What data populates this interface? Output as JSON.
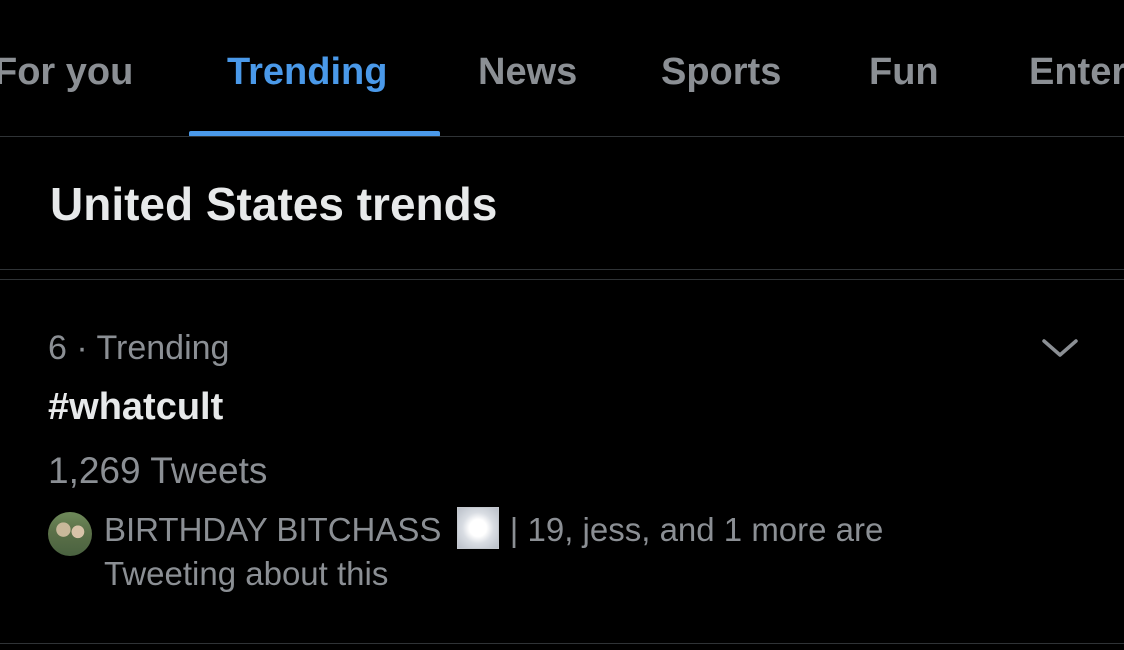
{
  "tabs": [
    {
      "label": "For you",
      "active": false
    },
    {
      "label": "Trending",
      "active": true
    },
    {
      "label": "News",
      "active": false
    },
    {
      "label": "Sports",
      "active": false
    },
    {
      "label": "Fun",
      "active": false
    },
    {
      "label": "Entertainment",
      "active": false
    }
  ],
  "section": {
    "title": "United States trends"
  },
  "trend": {
    "meta": "6 · Trending",
    "name": "#whatcult",
    "count": "1,269 Tweets",
    "social_name": "BIRTHDAY BITCHASS",
    "social_rest": "| 19, jess, and 1 more are Tweeting about this",
    "menu_icon": "chevron-down-icon",
    "emoji_icon": "sparkle-emoji-icon"
  },
  "colors": {
    "background": "#000000",
    "accent": "#4a99e9",
    "secondary_text": "#8b8f94",
    "primary_text": "#e7e9ea",
    "divider": "#2f3336"
  }
}
